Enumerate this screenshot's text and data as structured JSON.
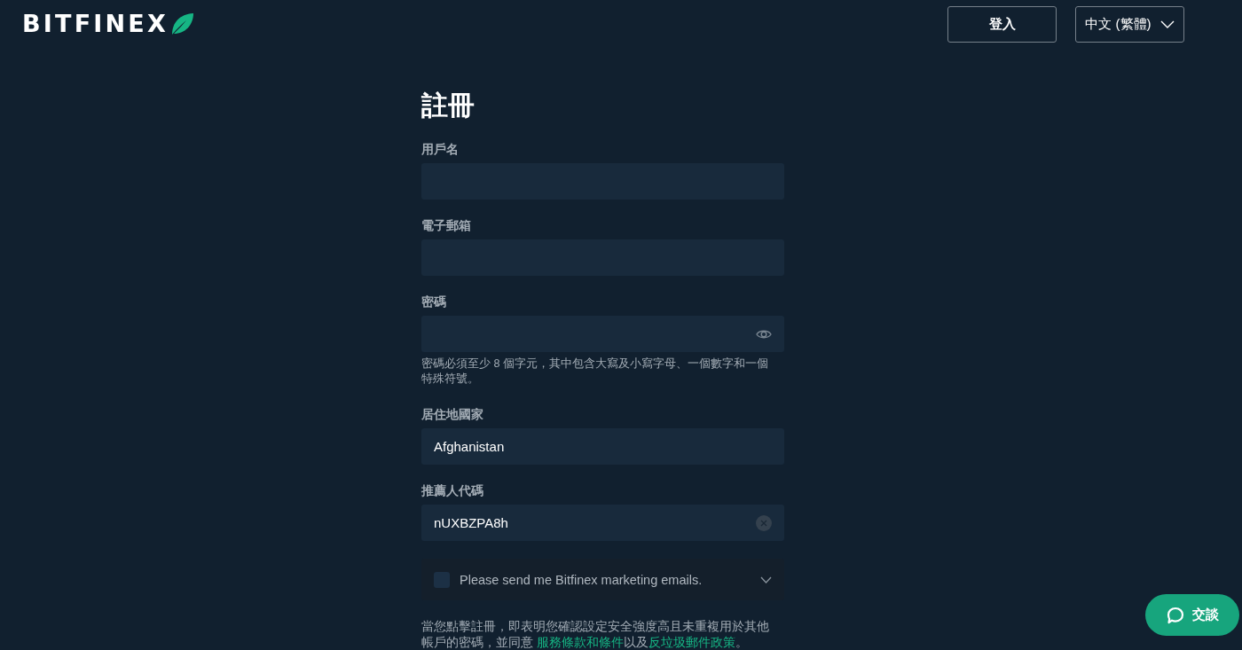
{
  "header": {
    "logo": "BITFINEX",
    "buttons": [
      {
        "label": "登入",
        "kind": "button"
      },
      {
        "label": "中文 (繁體)",
        "kind": "dropdown"
      }
    ]
  },
  "form": {
    "title": "註冊",
    "fields": [
      {
        "label": "用戶名",
        "kind": "text"
      },
      {
        "label": "電子郵箱",
        "kind": "text"
      },
      {
        "label": "密碼",
        "kind": "password",
        "hint": "密碼必須至少 8 個字元，其中包含大寫及小寫字母、一個數字和一個特殊符號。"
      },
      {
        "label": "居住地國家",
        "kind": "select",
        "value": "Afghanistan"
      },
      {
        "label": "推薦人代碼",
        "kind": "clearable",
        "value": "nUXBZPA8h"
      }
    ],
    "marketing": {
      "label": "Please send me Bitfinex marketing emails.",
      "checked": false,
      "expanded": false
    },
    "terms": [
      {
        "kind": "text",
        "text": "當您點擊註冊，即表明您確認設定安全強度高且未重複用於其他帳戶的密碼，並同意 "
      },
      {
        "kind": "link",
        "text": "服務條款和條件"
      },
      {
        "kind": "text",
        "text": "以及"
      },
      {
        "kind": "link",
        "text": "反垃圾郵件政策"
      },
      {
        "kind": "text",
        "text": "。"
      }
    ]
  },
  "chat": {
    "label": "交談"
  }
}
